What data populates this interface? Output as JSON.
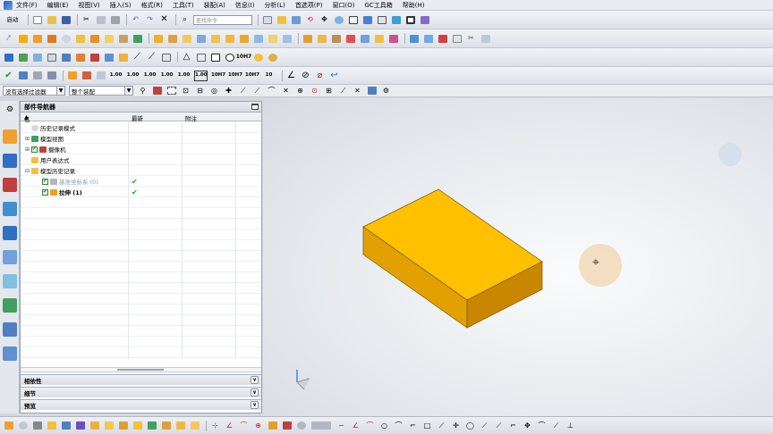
{
  "menu": [
    "文件(F)",
    "编辑(E)",
    "视图(V)",
    "插入(S)",
    "格式(R)",
    "工具(T)",
    "装配(A)",
    "信息(I)",
    "分析(L)",
    "首选项(P)",
    "窗口(O)",
    "GC工具箱",
    "帮助(H)"
  ],
  "toolbar1": {
    "start_label": "启动",
    "search_placeholder": "查找命令"
  },
  "selbar": {
    "filter": "没有选择过滤器",
    "scope": "整个装配"
  },
  "navigator": {
    "title": "部件导航器",
    "columns": [
      "名称",
      "最新",
      "附注"
    ],
    "rows": [
      {
        "label": "历史记录模式",
        "latest": ""
      },
      {
        "label": "模型视图",
        "latest": ""
      },
      {
        "label": "摄像机",
        "latest": ""
      },
      {
        "label": "用户表达式",
        "latest": ""
      },
      {
        "label": "模型历史记录",
        "latest": ""
      },
      {
        "label": "基准坐标系 (0)",
        "latest": "✔"
      },
      {
        "label": "拉伸 (1)",
        "latest": "✔"
      }
    ],
    "panels": [
      "相依性",
      "细节",
      "预览"
    ]
  },
  "dim_icons": [
    "1.00",
    "1.00",
    "1.00",
    "1.00",
    "1.00",
    "1.00",
    "10H7",
    "10H7",
    "10H7",
    "10"
  ],
  "colors": {
    "block_top": "#FFC000",
    "block_front": "#E3A100",
    "block_side": "#C98700",
    "accent": "#2f6fc8",
    "ok": "#1fa01f"
  },
  "icons": {
    "triad": "wcs-triad-icon",
    "cursor": "crosshair-cursor-icon"
  }
}
